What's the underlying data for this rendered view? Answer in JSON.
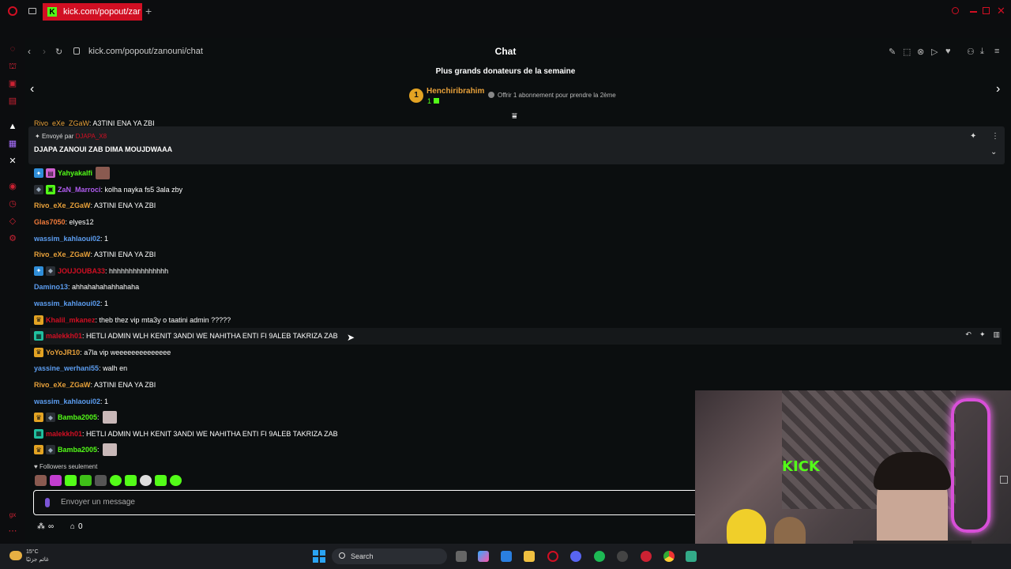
{
  "browser": {
    "tab_title": "kick.com/popout/zanouni",
    "url": "kick.com/popout/zanouni/chat",
    "new_tab": "+"
  },
  "chat": {
    "title": "Chat",
    "donors_heading": "Plus grands donateurs de la semaine",
    "top_donor": {
      "rank": "1",
      "name": "Henchiribrahim",
      "amount": "1"
    },
    "offer_text": "Offrir 1 abonnement pour prendre la 2ème",
    "hidden_line": {
      "user": "Rivo_eXe_ZGaW",
      "text": ": A3TINI ENA YA ZBI"
    },
    "pinned": {
      "sent_by_label": "Envoyé par",
      "sent_by_user": "DJAPA_X8",
      "text": "DJAPA ZANOUI ZAB DIMA MOUJDWAAA"
    },
    "messages": [
      {
        "badges": [
          "sub",
          "mod"
        ],
        "user": "Yahyakalfi",
        "color": "#53fc18",
        "text": "",
        "emote": "brown"
      },
      {
        "badges": [
          "verified",
          "gift"
        ],
        "user": "ZaN_Marroci",
        "color": "#b05cf0",
        "text": ": kolha nayka fs5 3ala zby"
      },
      {
        "badges": [],
        "user": "Rivo_eXe_ZGaW",
        "color": "#e8a13a",
        "text": ": A3TINI ENA YA ZBI"
      },
      {
        "badges": [],
        "user": "Glas7050",
        "color": "#f07a3a",
        "text": ": elyes12"
      },
      {
        "badges": [],
        "user": "wassim_kahlaoui02",
        "color": "#5c9df0",
        "text": ": 1"
      },
      {
        "badges": [],
        "user": "Rivo_eXe_ZGaW",
        "color": "#e8a13a",
        "text": ": A3TINI ENA YA ZBI"
      },
      {
        "badges": [
          "sub",
          "verified"
        ],
        "user": "JOUJOUBA33",
        "color": "#d10f23",
        "text": ": hhhhhhhhhhhhhhh"
      },
      {
        "badges": [],
        "user": "Damino13",
        "color": "#5c9df0",
        "text": ": ahhahahahahhahaha"
      },
      {
        "badges": [],
        "user": "wassim_kahlaoui02",
        "color": "#5c9df0",
        "text": ": 1"
      },
      {
        "badges": [
          "crown"
        ],
        "user": "Khalil_mkanez",
        "color": "#d10f23",
        "text": ": theb thez vip mta3y o taatini admin ?????"
      },
      {
        "badges": [
          "vip"
        ],
        "user": "malekkh01",
        "color": "#d10f23",
        "text": ": HETLI ADMIN WLH KENIT 3ANDI WE NAHITHA ENTI FI 9ALEB TAKRIZA ZAB",
        "highlight": true
      },
      {
        "badges": [
          "crown"
        ],
        "user": "YoYoJR10",
        "color": "#e8a13a",
        "text": ": a7la vip weeeeeeeeeeeeee"
      },
      {
        "badges": [],
        "user": "yassine_werhani55",
        "color": "#5c9df0",
        "text": ": walh en"
      },
      {
        "badges": [],
        "user": "Rivo_eXe_ZGaW",
        "color": "#e8a13a",
        "text": ": A3TINI ENA YA ZBI"
      },
      {
        "badges": [],
        "user": "wassim_kahlaoui02",
        "color": "#5c9df0",
        "text": ": 1"
      },
      {
        "badges": [
          "crown",
          "verified"
        ],
        "user": "Bamba2005",
        "color": "#53fc18",
        "text": ":",
        "emote": "pale"
      },
      {
        "badges": [
          "vip"
        ],
        "user": "malekkh01",
        "color": "#d10f23",
        "text": ": HETLI ADMIN WLH KENIT 3ANDI WE NAHITHA ENTI FI 9ALEB TAKRIZA ZAB"
      },
      {
        "badges": [
          "crown",
          "verified"
        ],
        "user": "Bamba2005",
        "color": "#53fc18",
        "text": ":",
        "emote": "pale"
      }
    ],
    "followers_only": "Followers seulement",
    "input_placeholder": "Envoyer un message",
    "footer_count": "0"
  },
  "webcam": {
    "sign_text": "KICK"
  },
  "taskbar": {
    "temperature": "15°C",
    "weather_text": "غائم جزئيًا",
    "search_label": "Search"
  },
  "colors": {
    "kick_green": "#53fc18",
    "opera_red": "#d10f23",
    "donor_gold": "#e3a323"
  }
}
